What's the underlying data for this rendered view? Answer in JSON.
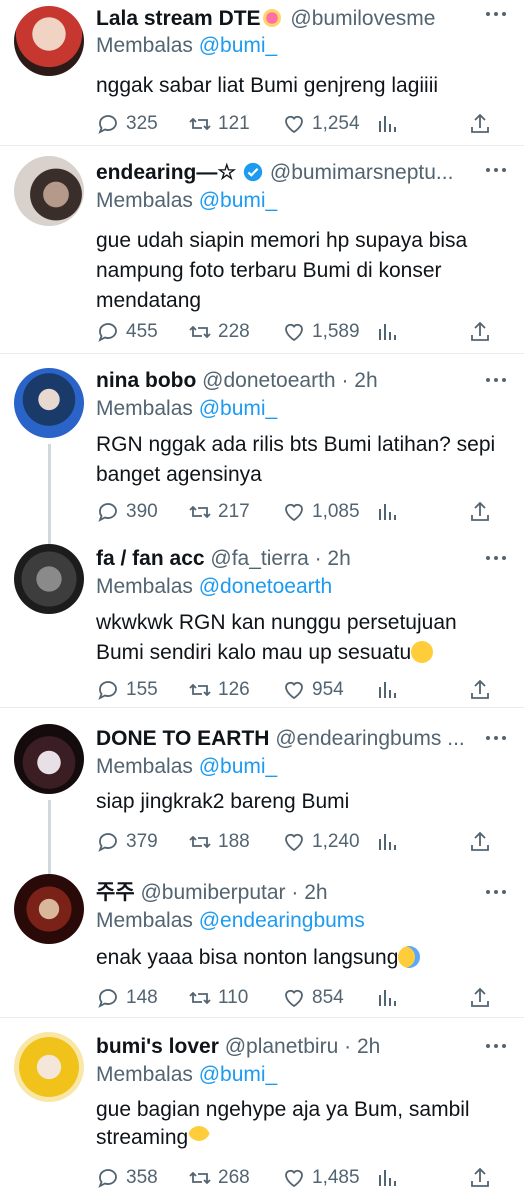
{
  "tweets": [
    {
      "name": "Lala stream DTE",
      "handle": "@bumilovesme",
      "time": "",
      "reply_label": "Membalas",
      "reply_to": "@bumi_",
      "text": "nggak sabar liat Bumi genjreng lagiiii",
      "emoji": "",
      "replies": "325",
      "retweets": "121",
      "likes": "1,254"
    },
    {
      "name": "endearing—☆",
      "handle": "@bumimarsneptu...",
      "time": "",
      "reply_label": "Membalas",
      "reply_to": "@bumi_",
      "text": "gue udah siapin memori hp supaya bisa nampung foto terbaru Bumi di konser mendatang",
      "emoji": "",
      "replies": "455",
      "retweets": "228",
      "likes": "1,589"
    },
    {
      "name": "nina bobo",
      "handle": "@donetoearth",
      "time": "· 2h",
      "reply_label": "Membalas",
      "reply_to": "@bumi_",
      "text": "RGN nggak ada rilis bts Bumi latihan? sepi banget agensinya",
      "emoji": "",
      "replies": "390",
      "retweets": "217",
      "likes": "1,085"
    },
    {
      "name": "fa / fan acc",
      "handle": "@fa_tierra",
      "time": "· 2h",
      "reply_label": "Membalas",
      "reply_to": "@donetoearth",
      "text": "wkwkwk RGN kan nunggu persetujuan Bumi sendiri kalo mau up sesuatu",
      "emoji": "rofl",
      "replies": "155",
      "retweets": "126",
      "likes": "954"
    },
    {
      "name": "DONE TO EARTH",
      "handle": "@endearingbums ...",
      "time": "",
      "reply_label": "Membalas",
      "reply_to": "@bumi_",
      "text": "siap jingkrak2 bareng Bumi",
      "emoji": "",
      "replies": "379",
      "retweets": "188",
      "likes": "1,240"
    },
    {
      "name": "주주",
      "handle": "@bumiberputar",
      "time": "· 2h",
      "reply_label": "Membalas",
      "reply_to": "@endearingbums",
      "text": "enak yaaa bisa nonton langsung",
      "emoji": "cry",
      "replies": "148",
      "retweets": "110",
      "likes": "854"
    },
    {
      "name": "bumi's lover",
      "handle": "@planetbiru",
      "time": "· 2h",
      "reply_label": "Membalas",
      "reply_to": "@bumi_",
      "text": "gue bagian ngehype aja ya Bum, sambil streaming",
      "emoji": "grin",
      "replies": "358",
      "retweets": "268",
      "likes": "1,485"
    }
  ],
  "colors": {
    "accent": "#1d9bf0",
    "secondary_text": "#536471",
    "text": "#0f1419",
    "divider": "#e6ecf0",
    "thread_line": "#cfd9de"
  },
  "icons": [
    "reply-icon",
    "retweet-icon",
    "like-icon",
    "views-icon",
    "share-icon",
    "more-icon",
    "verified-icon",
    "heart-emoji-icon"
  ]
}
